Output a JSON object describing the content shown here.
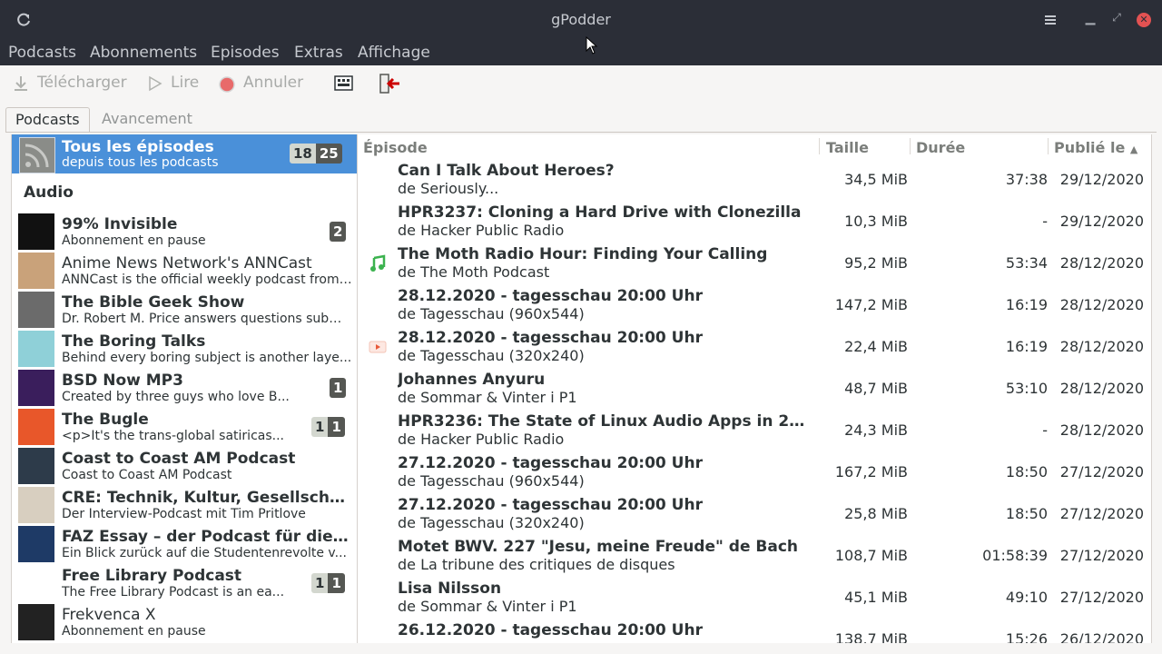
{
  "window": {
    "title": "gPodder"
  },
  "menubar": [
    "Podcasts",
    "Abonnements",
    "Episodes",
    "Extras",
    "Affichage"
  ],
  "toolbar": {
    "download": "Télécharger",
    "play": "Lire",
    "cancel": "Annuler"
  },
  "tabs": {
    "podcasts": "Podcasts",
    "progress": "Avancement"
  },
  "all_episodes": {
    "title": "Tous les épisodes",
    "subtitle": "depuis tous les podcasts",
    "badge_new": "18",
    "badge_downloaded": "25"
  },
  "section_label": "Audio",
  "podcasts": [
    {
      "name": "99% Invisible",
      "desc": "Abonnement en pause",
      "bold": true,
      "badges": [
        {
          "v": "2",
          "k": "dark"
        }
      ],
      "thumb_color": "#111111"
    },
    {
      "name": "Anime News Network's ANNCast",
      "desc": "ANNCast is the official weekly podcast from ...",
      "bold": false,
      "badges": [],
      "thumb_color": "#c9a27a"
    },
    {
      "name": "The Bible Geek Show",
      "desc": "Dr. Robert M. Price answers questions subm...",
      "bold": true,
      "badges": [],
      "thumb_color": "#6b6b6b"
    },
    {
      "name": "The Boring Talks",
      "desc": "Behind every boring subject is another laye...",
      "bold": true,
      "badges": [],
      "thumb_color": "#8fd0d8"
    },
    {
      "name": "BSD Now MP3",
      "desc": "Created by three guys who love B...",
      "bold": true,
      "badges": [
        {
          "v": "1",
          "k": "dark"
        }
      ],
      "thumb_color": "#3a1e5c"
    },
    {
      "name": "The Bugle",
      "desc": "<p>It's the trans-global satiricas...",
      "bold": true,
      "badges": [
        {
          "v": "1",
          "k": "grey"
        },
        {
          "v": "1",
          "k": "dark"
        }
      ],
      "thumb_color": "#e8572a"
    },
    {
      "name": "Coast to Coast AM Podcast",
      "desc": "Coast to Coast AM Podcast",
      "bold": true,
      "badges": [],
      "thumb_color": "#2d3b4a"
    },
    {
      "name": "CRE: Technik, Kultur, Gesellschaft",
      "desc": "Der Interview-Podcast mit Tim Pritlove",
      "bold": true,
      "badges": [],
      "thumb_color": "#d8cfc0"
    },
    {
      "name": "FAZ Essay – der Podcast für die ...",
      "desc": "Ein Blick zurück auf die Studentenrevolte v...",
      "bold": true,
      "badges": [],
      "thumb_color": "#1e3a66"
    },
    {
      "name": "Free Library Podcast",
      "desc": "The Free Library Podcast is an ea...",
      "bold": true,
      "badges": [
        {
          "v": "1",
          "k": "grey"
        },
        {
          "v": "1",
          "k": "dark"
        }
      ],
      "thumb_color": "#ffffff"
    },
    {
      "name": "Frekvenca X",
      "desc": "Abonnement en pause",
      "bold": false,
      "badges": [],
      "thumb_color": "#222222"
    }
  ],
  "episode_columns": {
    "episode": "Épisode",
    "size": "Taille",
    "duration": "Durée",
    "published": "Publié le"
  },
  "episodes": [
    {
      "title": "Can I Talk About Heroes?",
      "podcast": "de Seriously...",
      "size": "34,5 MiB",
      "duration": "37:38",
      "date": "29/12/2020",
      "icon": ""
    },
    {
      "title": "HPR3237: Cloning a Hard Drive with Clonezilla",
      "podcast": "de Hacker Public Radio",
      "size": "10,3 MiB",
      "duration": "-",
      "date": "29/12/2020",
      "icon": ""
    },
    {
      "title": "The Moth Radio Hour: Finding Your Calling",
      "podcast": "de The Moth Podcast",
      "size": "95,2 MiB",
      "duration": "53:34",
      "date": "28/12/2020",
      "icon": "audio"
    },
    {
      "title": "28.12.2020 - tagesschau 20:00 Uhr",
      "podcast": "de Tagesschau (960x544)",
      "size": "147,2 MiB",
      "duration": "16:19",
      "date": "28/12/2020",
      "icon": ""
    },
    {
      "title": "28.12.2020 - tagesschau 20:00 Uhr",
      "podcast": "de Tagesschau (320x240)",
      "size": "22,4 MiB",
      "duration": "16:19",
      "date": "28/12/2020",
      "icon": "video"
    },
    {
      "title": "Johannes Anyuru",
      "podcast": "de Sommar & Vinter i P1",
      "size": "48,7 MiB",
      "duration": "53:10",
      "date": "28/12/2020",
      "icon": ""
    },
    {
      "title": "HPR3236: The State of Linux Audio Apps in 20...",
      "podcast": "de Hacker Public Radio",
      "size": "24,3 MiB",
      "duration": "-",
      "date": "28/12/2020",
      "icon": ""
    },
    {
      "title": "27.12.2020 - tagesschau 20:00 Uhr",
      "podcast": "de Tagesschau (960x544)",
      "size": "167,2 MiB",
      "duration": "18:50",
      "date": "27/12/2020",
      "icon": ""
    },
    {
      "title": "27.12.2020 - tagesschau 20:00 Uhr",
      "podcast": "de Tagesschau (320x240)",
      "size": "25,8 MiB",
      "duration": "18:50",
      "date": "27/12/2020",
      "icon": ""
    },
    {
      "title": "Motet BWV. 227 \"Jesu, meine Freude\" de Bach",
      "podcast": "de La tribune des critiques de disques",
      "size": "108,7 MiB",
      "duration": "01:58:39",
      "date": "27/12/2020",
      "icon": ""
    },
    {
      "title": "Lisa Nilsson",
      "podcast": "de Sommar & Vinter i P1",
      "size": "45,1 MiB",
      "duration": "49:10",
      "date": "27/12/2020",
      "icon": ""
    },
    {
      "title": "26.12.2020 - tagesschau 20:00 Uhr",
      "podcast": "",
      "size": "138,7 MiB",
      "duration": "15:26",
      "date": "26/12/2020",
      "icon": ""
    }
  ],
  "colors": {
    "selection": "#4a90d9",
    "titlebar": "#2b2e37",
    "close": "#e25252",
    "audio_icon": "#3bb24e",
    "video_icon": "#e85a3a"
  }
}
